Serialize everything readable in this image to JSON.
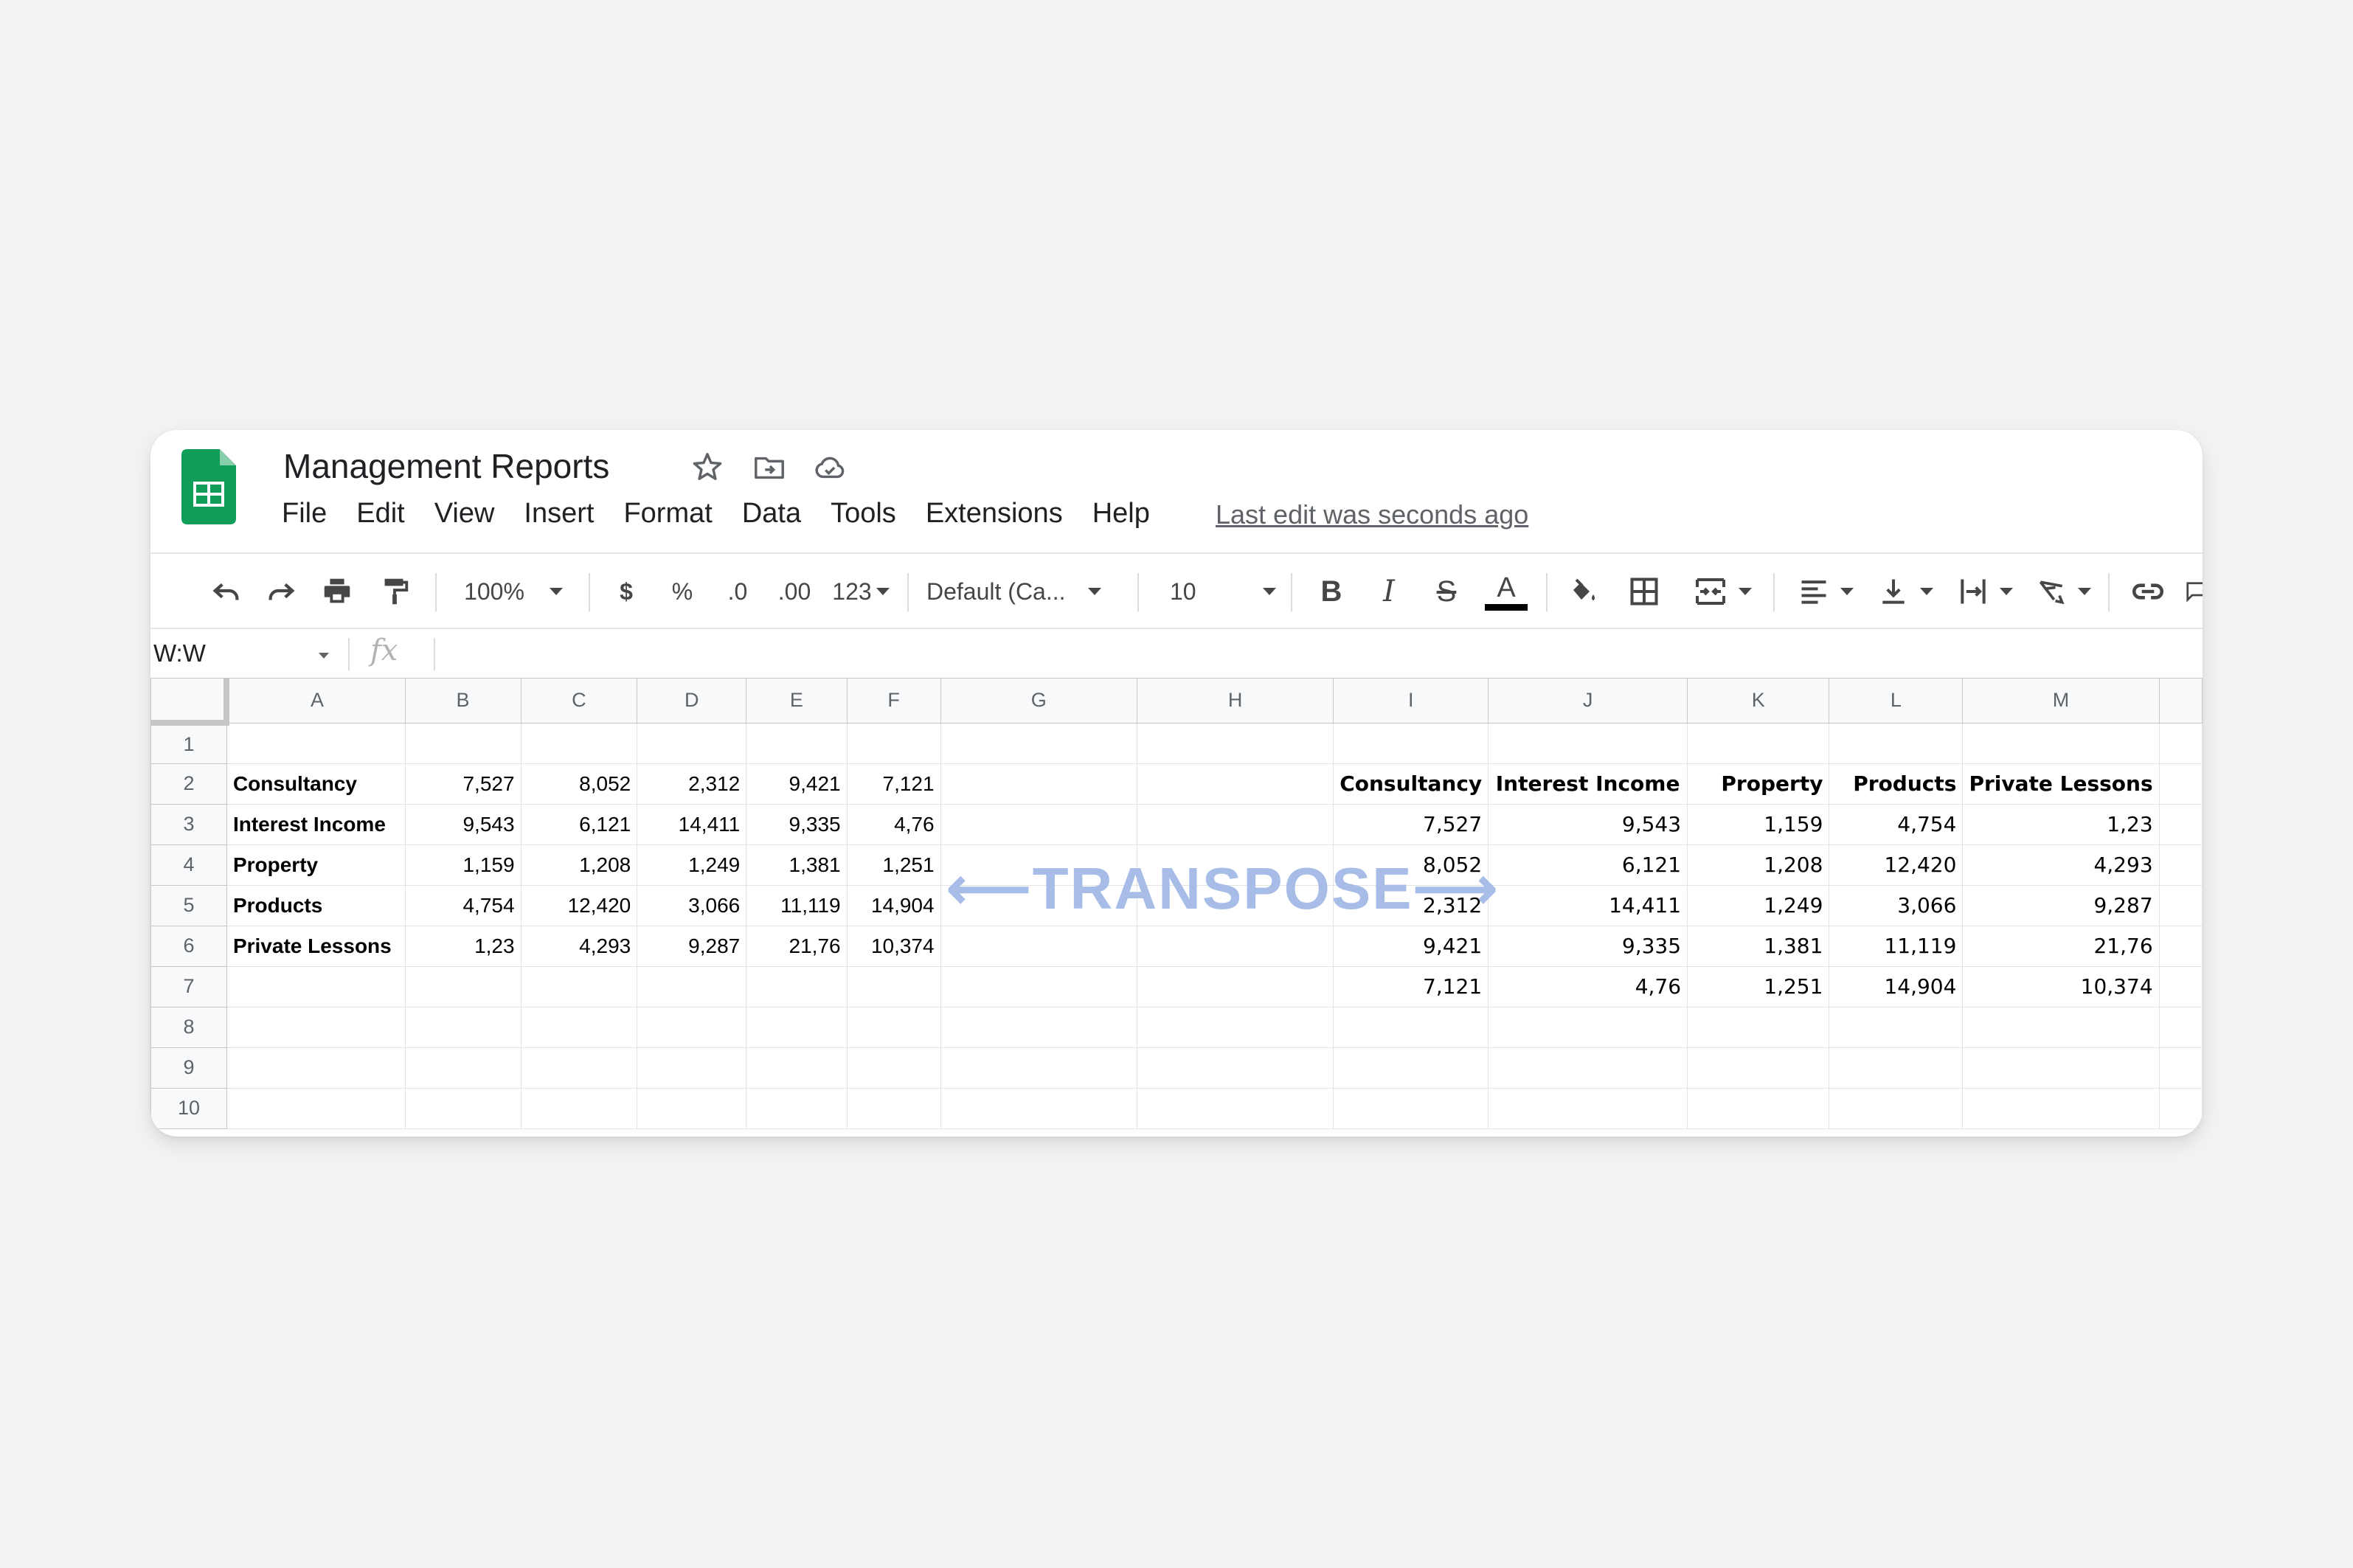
{
  "app": {
    "title": "Management Reports",
    "menu": [
      "File",
      "Edit",
      "View",
      "Insert",
      "Format",
      "Data",
      "Tools",
      "Extensions",
      "Help"
    ],
    "last_edit": "Last edit was seconds ago",
    "brand_color": "#0f9d58"
  },
  "toolbar": {
    "zoom": "100%",
    "currency": "$",
    "percent": "%",
    "decrease_decimal": ".0",
    "increase_decimal": ".00",
    "more_formats": "123",
    "font": "Default (Ca...",
    "font_size": "10",
    "bold": "B",
    "italic": "I",
    "strikethrough": "S",
    "text_color": "A"
  },
  "formula_bar": {
    "name_box": "W:W",
    "fx": "fx",
    "content": ""
  },
  "sheet": {
    "columns": [
      "A",
      "B",
      "C",
      "D",
      "E",
      "F",
      "G",
      "H",
      "I",
      "J",
      "K",
      "L",
      "M"
    ],
    "rows": [
      "1",
      "2",
      "3",
      "4",
      "5",
      "6",
      "7",
      "8",
      "9",
      "10"
    ],
    "left_table": [
      [
        "Consultancy",
        "7,527",
        "8,052",
        "2,312",
        "9,421",
        "7,121"
      ],
      [
        "Interest Income",
        "9,543",
        "6,121",
        "14,411",
        "9,335",
        "4,76"
      ],
      [
        "Property",
        "1,159",
        "1,208",
        "1,249",
        "1,381",
        "1,251"
      ],
      [
        "Products",
        "4,754",
        "12,420",
        "3,066",
        "11,119",
        "14,904"
      ],
      [
        "Private Lessons",
        "1,23",
        "4,293",
        "9,287",
        "21,76",
        "10,374"
      ]
    ],
    "right_table": {
      "headers": [
        "Consultancy",
        "Interest Income",
        "Property",
        "Products",
        "Private Lessons"
      ],
      "rows": [
        [
          "7,527",
          "9,543",
          "1,159",
          "4,754",
          "1,23"
        ],
        [
          "8,052",
          "6,121",
          "1,208",
          "12,420",
          "4,293"
        ],
        [
          "2,312",
          "14,411",
          "1,249",
          "3,066",
          "9,287"
        ],
        [
          "9,421",
          "9,335",
          "1,381",
          "11,119",
          "21,76"
        ],
        [
          "7,121",
          "4,76",
          "1,251",
          "14,904",
          "10,374"
        ]
      ]
    }
  },
  "overlay": {
    "label": "⟵TRANSPOSE⟶",
    "color": "#a7bde8"
  }
}
